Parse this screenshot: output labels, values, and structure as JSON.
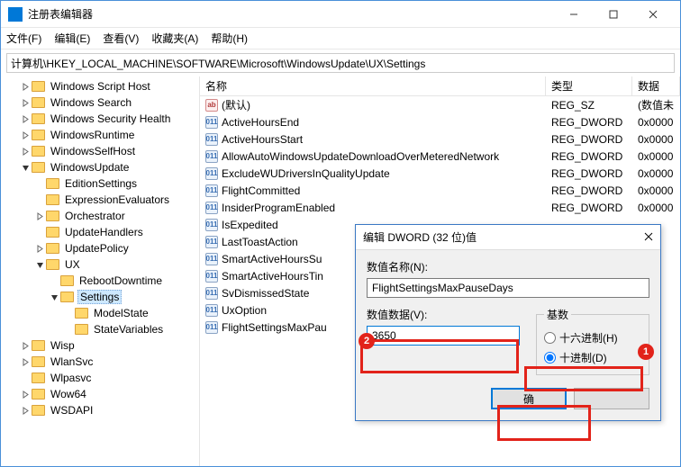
{
  "window": {
    "title": "注册表编辑器",
    "minimize": "—",
    "close": "×"
  },
  "menu": {
    "file": "文件(F)",
    "edit": "编辑(E)",
    "view": "查看(V)",
    "favorites": "收藏夹(A)",
    "help": "帮助(H)"
  },
  "address": "计算机\\HKEY_LOCAL_MACHINE\\SOFTWARE\\Microsoft\\WindowsUpdate\\UX\\Settings",
  "tree": [
    {
      "label": "Windows Script Host",
      "indent": 1,
      "tw": "right"
    },
    {
      "label": "Windows Search",
      "indent": 1,
      "tw": "right"
    },
    {
      "label": "Windows Security Health",
      "indent": 1,
      "tw": "right"
    },
    {
      "label": "WindowsRuntime",
      "indent": 1,
      "tw": "right"
    },
    {
      "label": "WindowsSelfHost",
      "indent": 1,
      "tw": "right"
    },
    {
      "label": "WindowsUpdate",
      "indent": 1,
      "tw": "down"
    },
    {
      "label": "EditionSettings",
      "indent": 2,
      "tw": ""
    },
    {
      "label": "ExpressionEvaluators",
      "indent": 2,
      "tw": ""
    },
    {
      "label": "Orchestrator",
      "indent": 2,
      "tw": "right"
    },
    {
      "label": "UpdateHandlers",
      "indent": 2,
      "tw": ""
    },
    {
      "label": "UpdatePolicy",
      "indent": 2,
      "tw": "right"
    },
    {
      "label": "UX",
      "indent": 2,
      "tw": "down"
    },
    {
      "label": "RebootDowntime",
      "indent": 3,
      "tw": ""
    },
    {
      "label": "Settings",
      "indent": 3,
      "tw": "down",
      "selected": true
    },
    {
      "label": "ModelState",
      "indent": 4,
      "tw": ""
    },
    {
      "label": "StateVariables",
      "indent": 4,
      "tw": ""
    },
    {
      "label": "Wisp",
      "indent": 1,
      "tw": "right"
    },
    {
      "label": "WlanSvc",
      "indent": 1,
      "tw": "right"
    },
    {
      "label": "Wlpasvc",
      "indent": 1,
      "tw": ""
    },
    {
      "label": "Wow64",
      "indent": 1,
      "tw": "right"
    },
    {
      "label": "WSDAPI",
      "indent": 1,
      "tw": "right"
    }
  ],
  "list": {
    "headers": {
      "name": "名称",
      "type": "类型",
      "data": "数据"
    },
    "rows": [
      {
        "icon": "str",
        "name": "(默认)",
        "type": "REG_SZ",
        "data": "(数值未"
      },
      {
        "icon": "bin",
        "name": "ActiveHoursEnd",
        "type": "REG_DWORD",
        "data": "0x0000"
      },
      {
        "icon": "bin",
        "name": "ActiveHoursStart",
        "type": "REG_DWORD",
        "data": "0x0000"
      },
      {
        "icon": "bin",
        "name": "AllowAutoWindowsUpdateDownloadOverMeteredNetwork",
        "type": "REG_DWORD",
        "data": "0x0000"
      },
      {
        "icon": "bin",
        "name": "ExcludeWUDriversInQualityUpdate",
        "type": "REG_DWORD",
        "data": "0x0000"
      },
      {
        "icon": "bin",
        "name": "FlightCommitted",
        "type": "REG_DWORD",
        "data": "0x0000"
      },
      {
        "icon": "bin",
        "name": "InsiderProgramEnabled",
        "type": "REG_DWORD",
        "data": "0x0000"
      },
      {
        "icon": "bin",
        "name": "IsExpedited",
        "type": "",
        "data": ""
      },
      {
        "icon": "bin",
        "name": "LastToastAction",
        "type": "",
        "data": ""
      },
      {
        "icon": "bin",
        "name": "SmartActiveHoursSu",
        "type": "",
        "data": ""
      },
      {
        "icon": "bin",
        "name": "SmartActiveHoursTin",
        "type": "",
        "data": ""
      },
      {
        "icon": "bin",
        "name": "SvDismissedState",
        "type": "",
        "data": ""
      },
      {
        "icon": "bin",
        "name": "UxOption",
        "type": "",
        "data": ""
      },
      {
        "icon": "bin",
        "name": "FlightSettingsMaxPau",
        "type": "",
        "data": ""
      }
    ]
  },
  "dialog": {
    "title": "编辑 DWORD (32 位)值",
    "name_label": "数值名称(N):",
    "name_value": "FlightSettingsMaxPauseDays",
    "data_label": "数值数据(V):",
    "data_value": "3650",
    "radix_legend": "基数",
    "radix_hex": "十六进制(H)",
    "radix_dec": "十进制(D)",
    "ok": "确",
    "cancel": ""
  },
  "annotations": {
    "badge1": "1",
    "badge2": "2"
  }
}
